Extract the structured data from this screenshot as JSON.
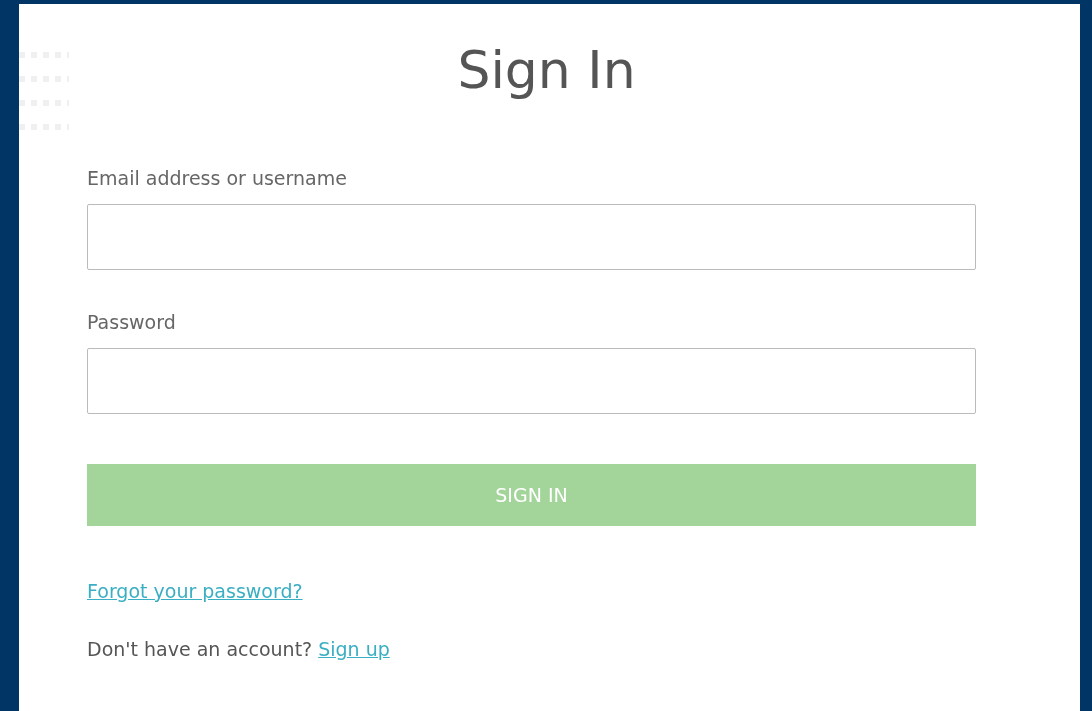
{
  "title": "Sign In",
  "fields": [
    {
      "label": "Email address or username"
    },
    {
      "label": "Password"
    }
  ],
  "submit": {
    "label": "SIGN IN"
  },
  "forgot_link": "Forgot your password?",
  "signup": {
    "prompt": "Don't have an account?",
    "link": "Sign up"
  }
}
